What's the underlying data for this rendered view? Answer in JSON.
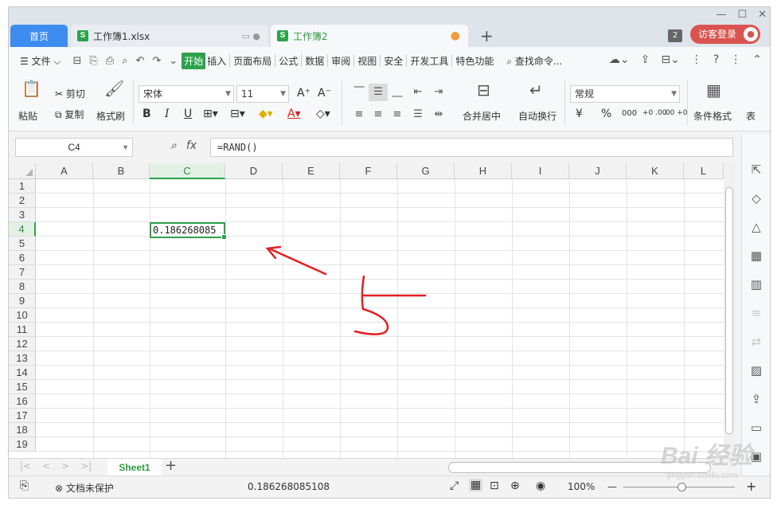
{
  "window": {
    "minimize": "—",
    "maximize": "☐",
    "close": "✕"
  },
  "tabs": {
    "home": "首页",
    "file1": "工作簿1.xlsx",
    "file1_extra": "▭ ●",
    "file2": "工作簿2",
    "file2_dot": "●",
    "file_icon": "S",
    "add": "+",
    "window_count": "2",
    "visitor_login": "访客登录",
    "visitor_avatar": "●"
  },
  "menu": {
    "file": "☰ 文件 ⌵",
    "items": [
      "开始",
      "插入",
      "页面布局",
      "公式",
      "数据",
      "审阅",
      "视图",
      "安全",
      "开发工具",
      "特色功能"
    ],
    "active_index": 0,
    "find_command": "查找命令...",
    "quick_icons": [
      "⊟",
      "⎘",
      "⎙",
      "⌕",
      "↶",
      "↷",
      "⌄"
    ],
    "right_icons": [
      "☁⌄",
      "⇪",
      "⊟⌄",
      "⋮",
      "?",
      "⋮",
      "⌃"
    ]
  },
  "ribbon": {
    "paste": "粘贴",
    "cut": "剪切",
    "copy": "复制",
    "format_painter": "格式刷",
    "font_name": "宋体",
    "font_size": "11",
    "grow_font": "A⁺",
    "shrink_font": "A⁻",
    "bold": "B",
    "italic": "I",
    "underline": "U",
    "merge_center": "合并居中",
    "auto_wrap": "自动换行",
    "number_format": "常规",
    "currency": "¥",
    "percent": "%",
    "thousands": "000",
    "inc_decimal": "+0 .00",
    "dec_decimal": ".00 +0",
    "conditional_format": "条件格式",
    "table_style": "表"
  },
  "formula_bar": {
    "name_box": "C4",
    "fx": "fx",
    "formula": "=RAND()"
  },
  "grid": {
    "columns": [
      "A",
      "B",
      "C",
      "D",
      "E",
      "F",
      "G",
      "H",
      "I",
      "J",
      "K",
      "L"
    ],
    "rows": [
      "1",
      "2",
      "3",
      "4",
      "5",
      "6",
      "7",
      "8",
      "9",
      "10",
      "11",
      "12",
      "13",
      "14",
      "15",
      "16",
      "17",
      "18",
      "19"
    ],
    "selected_column": "C",
    "selected_row": "4",
    "active_cell_value": "0.186268085"
  },
  "sheets": {
    "nav": [
      "|<",
      "<",
      ">",
      ">|"
    ],
    "active": "Sheet1",
    "add": "+"
  },
  "statusbar": {
    "protection": "文档未保护",
    "sum_value": "0.186268085108",
    "zoom": "100%",
    "zoom_out": "—",
    "zoom_in": "+"
  },
  "side_panel": [
    "⇱",
    "◇",
    "△",
    "▦",
    "▥",
    "≡",
    "⇄",
    "▨",
    "⇪",
    "▭",
    "▣"
  ],
  "watermark": {
    "main": "Bai 经验",
    "sub": "jingyan.baidu.com"
  },
  "colors": {
    "accent_green": "#2ca24c",
    "home_tab": "#3f8cf0",
    "annotation_red": "#e02020"
  }
}
